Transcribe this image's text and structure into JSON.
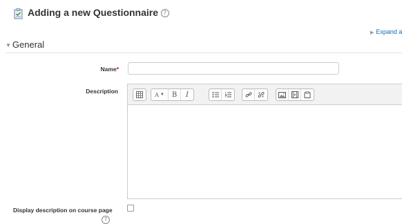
{
  "header": {
    "title": "Adding a new Questionnaire",
    "title_icon": "questionnaire-icon",
    "help_icon": "help-icon"
  },
  "expand_all": {
    "label": "Expand a"
  },
  "section": {
    "title": "General",
    "collapse_icon": "caret-down-icon"
  },
  "form": {
    "name": {
      "label": "Name",
      "required_marker": "*",
      "value": ""
    },
    "description": {
      "label": "Description",
      "toolbar_groups": [
        [
          "toolbar-toggle-icon"
        ],
        [
          "font-size-icon",
          "bold-icon",
          "italic-icon"
        ],
        [
          "bullet-list-icon",
          "numbered-list-icon"
        ],
        [
          "link-icon",
          "unlink-icon"
        ],
        [
          "image-icon",
          "media-icon",
          "manage-files-icon"
        ]
      ],
      "toolbar_text": {
        "font": "A",
        "bold": "B",
        "italic": "I"
      },
      "value": ""
    },
    "display_description": {
      "label": "Display description on course page",
      "checked": false
    }
  },
  "colors": {
    "link": "#0f6cbf",
    "required": "#cc0000",
    "toolbar_bg": "#f2f2f2"
  }
}
